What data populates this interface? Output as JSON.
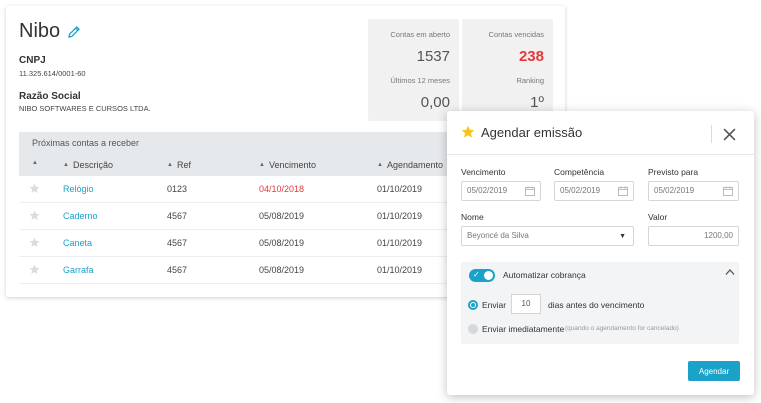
{
  "company": {
    "name": "Nibo",
    "cnpj_label": "CNPJ",
    "cnpj_value": "11.325.614/0001-60",
    "razao_label": "Razão Social",
    "razao_value": "NIBO SOFTWARES E CURSOS LTDA."
  },
  "stats": [
    {
      "label": "Contas em aberto",
      "value": "1537"
    },
    {
      "label": "Contas vencidas",
      "value": "238"
    },
    {
      "label": "Últimos 12 meses",
      "value": "0,00"
    },
    {
      "label": "Ranking",
      "value": "1º"
    }
  ],
  "table": {
    "section_title": "Próximas contas a receber",
    "columns": [
      "Descrição",
      "Ref",
      "Vencimento",
      "Agendamento"
    ],
    "rows": [
      {
        "descricao": "Relógio",
        "ref": "0123",
        "vencimento": "04/10/2018",
        "agendamento": "01/10/2019",
        "overdue": true
      },
      {
        "descricao": "Caderno",
        "ref": "4567",
        "vencimento": "05/08/2019",
        "agendamento": "01/10/2019",
        "overdue": false
      },
      {
        "descricao": "Caneta",
        "ref": "4567",
        "vencimento": "05/08/2019",
        "agendamento": "01/10/2019",
        "overdue": false
      },
      {
        "descricao": "Garrafa",
        "ref": "4567",
        "vencimento": "05/08/2019",
        "agendamento": "01/10/2019",
        "overdue": false
      }
    ]
  },
  "modal": {
    "title": "Agendar emissão",
    "fields": {
      "vencimento_label": "Vencimento",
      "vencimento_value": "05/02/2019",
      "competencia_label": "Competência",
      "competencia_value": "05/02/2019",
      "previsto_label": "Previsto para",
      "previsto_value": "05/02/2019",
      "nome_label": "Nome",
      "nome_value": "Beyoncé da Silva",
      "valor_label": "Valor",
      "valor_value": "1200,00"
    },
    "auto": {
      "toggle_label": "Automatizar cobrança",
      "enviar_label": "Enviar",
      "days_value": "10",
      "days_suffix": "dias antes do vencimento",
      "imediato_label": "Enviar imediatamente",
      "imediato_hint": "(quando o agendamento for cancelado)"
    },
    "submit_label": "Agendar"
  },
  "colors": {
    "accent": "#1aa2c9",
    "danger": "#e5383b",
    "star_gold": "#f5c518"
  }
}
